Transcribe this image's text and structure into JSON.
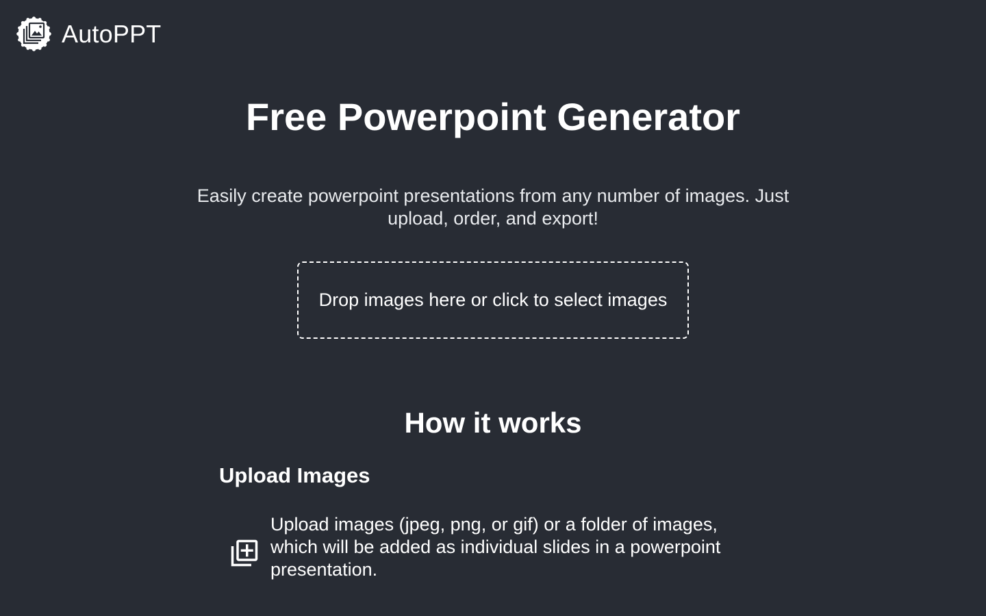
{
  "header": {
    "brand_name": "AutoPPT",
    "logo_icon": "stacked-images-logo-icon"
  },
  "hero": {
    "title": "Free Powerpoint Generator",
    "subtitle": "Easily create powerpoint presentations from any number of images. Just upload, order, and export!",
    "dropzone_label": "Drop images here or click to select images"
  },
  "how_it_works": {
    "title": "How it works",
    "steps": [
      {
        "title": "Upload Images",
        "icon": "add-to-library-icon",
        "description": "Upload images (jpeg, png, or gif) or a folder of images, which will be added as individual slides in a powerpoint presentation."
      }
    ]
  },
  "colors": {
    "background": "#282c34",
    "text": "#ffffff"
  }
}
